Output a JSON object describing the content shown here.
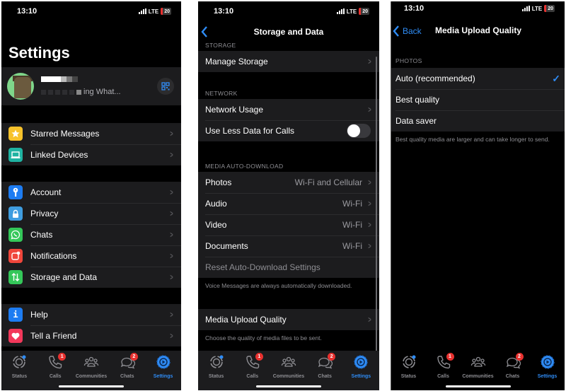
{
  "status_bar": {
    "time": "13:10",
    "network": "LTE",
    "battery": "20"
  },
  "colors": {
    "accent": "#2f8cf5",
    "background": "#000000",
    "cell": "#1c1c1e",
    "badge": "#e8312f",
    "secondary_text": "#8e8e93"
  },
  "tab_bar": {
    "tabs": [
      {
        "label": "Status",
        "icon": "status-icon",
        "badge": null
      },
      {
        "label": "Calls",
        "icon": "phone-icon",
        "badge": "1"
      },
      {
        "label": "Communities",
        "icon": "communities-icon",
        "badge": null
      },
      {
        "label": "Chats",
        "icon": "chat-bubbles-icon",
        "badge": "2"
      },
      {
        "label": "Settings",
        "icon": "settings-gear-icon",
        "badge": null
      }
    ],
    "active": "Settings"
  },
  "settings_screen": {
    "title": "Settings",
    "profile": {
      "name": "[redacted]",
      "status_suffix": "ing What...",
      "qr_icon": "qr-code-icon"
    },
    "groups": [
      [
        {
          "label": "Starred Messages",
          "icon": "star-icon",
          "color": "#f7c22b"
        },
        {
          "label": "Linked Devices",
          "icon": "laptop-icon",
          "color": "#1fb3a2"
        }
      ],
      [
        {
          "label": "Account",
          "icon": "key-icon",
          "color": "#1d7cf2"
        },
        {
          "label": "Privacy",
          "icon": "lock-icon",
          "color": "#3f9de0"
        },
        {
          "label": "Chats",
          "icon": "whatsapp-icon",
          "color": "#34c759"
        },
        {
          "label": "Notifications",
          "icon": "notification-icon",
          "color": "#f0463b"
        },
        {
          "label": "Storage and Data",
          "icon": "arrows-updown-icon",
          "color": "#34c759"
        }
      ],
      [
        {
          "label": "Help",
          "icon": "info-icon",
          "color": "#1d7cf2"
        },
        {
          "label": "Tell a Friend",
          "icon": "heart-icon",
          "color": "#f2385a"
        }
      ]
    ]
  },
  "storage_screen": {
    "title": "Storage and Data",
    "storage_header": "STORAGE",
    "manage_storage": "Manage Storage",
    "network_header": "NETWORK",
    "network_usage": "Network Usage",
    "less_data_calls": {
      "label": "Use Less Data for Calls",
      "enabled": false
    },
    "media_header": "MEDIA AUTO-DOWNLOAD",
    "media_rows": [
      {
        "label": "Photos",
        "value": "Wi-Fi and Cellular"
      },
      {
        "label": "Audio",
        "value": "Wi-Fi"
      },
      {
        "label": "Video",
        "value": "Wi-Fi"
      },
      {
        "label": "Documents",
        "value": "Wi-Fi"
      }
    ],
    "reset_label": "Reset Auto-Download Settings",
    "voice_note": "Voice Messages are always automatically downloaded.",
    "upload_quality": "Media Upload Quality",
    "upload_note": "Choose the quality of media files to be sent."
  },
  "upload_screen": {
    "back_label": "Back",
    "title": "Media Upload Quality",
    "photos_header": "PHOTOS",
    "options": [
      {
        "label": "Auto (recommended)",
        "selected": true
      },
      {
        "label": "Best quality",
        "selected": false
      },
      {
        "label": "Data saver",
        "selected": false
      }
    ],
    "note": "Best quality media are larger and can take longer to send."
  }
}
